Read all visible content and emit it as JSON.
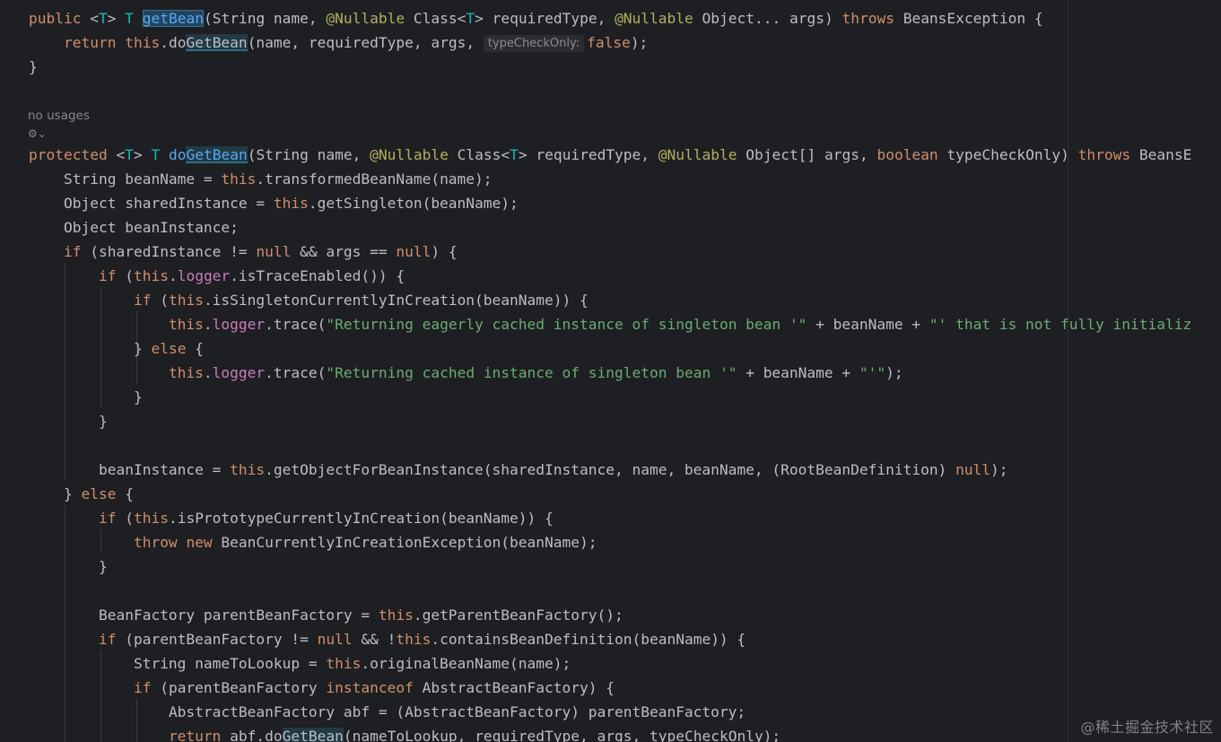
{
  "editor": {
    "lens": {
      "no_usages": "no usages"
    },
    "hint": {
      "param_name": "typeCheckOnly:"
    },
    "line1": {
      "mod": "public",
      "gen_open": "<",
      "type_param": "T",
      "gen_close": ">",
      "ret": "T",
      "name": "getBean",
      "params_a": "(String name, ",
      "ann1": "@Nullable",
      "params_b": " Class<",
      "type_param2": "T",
      "params_c": "> requiredType, ",
      "ann2": "@Nullable",
      "params_d": " Object... args) ",
      "throws_kw": "throws",
      "tail": " BeansException {"
    },
    "line2": {
      "ret_kw": "return",
      "this_kw": "this",
      "dot": ".do",
      "call": "GetBean",
      "args": "(name, requiredType, args, ",
      "false_kw": "false",
      "end": ");"
    },
    "line3": {
      "brace": "}"
    },
    "line4": {
      "mod": "protected",
      "gen_open": "<",
      "type_param": "T",
      "gen_close": ">",
      "ret": "T",
      "name_pre": "do",
      "name_hl": "GetBean",
      "params_a": "(String name, ",
      "ann1": "@Nullable",
      "params_b": " Class<",
      "type_param2": "T",
      "params_c": "> requiredType, ",
      "ann2": "@Nullable",
      "params_d": " Object[] args, ",
      "bool_kw": "boolean",
      "params_e": " typeCheckOnly) ",
      "throws_kw": "throws",
      "tail": " BeansE"
    },
    "line5": {
      "a": "String beanName = ",
      "this_kw": "this",
      "b": ".transformedBeanName(name);"
    },
    "line6": {
      "a": "Object sharedInstance = ",
      "this_kw": "this",
      "b": ".getSingleton(beanName);"
    },
    "line7": {
      "a": "Object beanInstance;"
    },
    "line8": {
      "if_kw": "if",
      "a": " (sharedInstance != ",
      "null1": "null",
      "b": " && args == ",
      "null2": "null",
      "c": ") {"
    },
    "line9": {
      "if_kw": "if",
      "a": " (",
      "this_kw": "this",
      "b": ".",
      "field": "logger",
      "c": ".isTraceEnabled()) {"
    },
    "line10": {
      "if_kw": "if",
      "a": " (",
      "this_kw": "this",
      "b": ".isSingletonCurrentlyInCreation(beanName)) {"
    },
    "line11": {
      "this_kw": "this",
      "b": ".",
      "field": "logger",
      "c": ".trace(",
      "s1": "\"Returning eagerly cached instance of singleton bean '\"",
      "d": " + beanName + ",
      "s2": "\"' that is not fully initializ"
    },
    "line12": {
      "a": "} ",
      "else_kw": "else",
      "b": " {"
    },
    "line13": {
      "this_kw": "this",
      "b": ".",
      "field": "logger",
      "c": ".trace(",
      "s1": "\"Returning cached instance of singleton bean '\"",
      "d": " + beanName + ",
      "s2": "\"'\"",
      "e": ");"
    },
    "line14": {
      "brace": "}"
    },
    "line15": {
      "brace": "}"
    },
    "line16": {
      "a": "beanInstance = ",
      "this_kw": "this",
      "b": ".getObjectForBeanInstance(sharedInstance, name, beanName, (RootBeanDefinition) ",
      "null_kw": "null",
      "c": ");"
    },
    "line17": {
      "a": "} ",
      "else_kw": "else",
      "b": " {"
    },
    "line18": {
      "if_kw": "if",
      "a": " (",
      "this_kw": "this",
      "b": ".isPrototypeCurrentlyInCreation(beanName)) {"
    },
    "line19": {
      "throw_kw": "throw",
      "sp": " ",
      "new_kw": "new",
      "b": " BeanCurrentlyInCreationException(beanName);"
    },
    "line20": {
      "brace": "}"
    },
    "line21": {
      "a": "BeanFactory parentBeanFactory = ",
      "this_kw": "this",
      "b": ".getParentBeanFactory();"
    },
    "line22": {
      "if_kw": "if",
      "a": " (parentBeanFactory != ",
      "null_kw": "null",
      "b": " && !",
      "this_kw": "this",
      "c": ".containsBeanDefinition(beanName)) {"
    },
    "line23": {
      "a": "String nameToLookup = ",
      "this_kw": "this",
      "b": ".originalBeanName(name);"
    },
    "line24": {
      "if_kw": "if",
      "a": " (parentBeanFactory ",
      "inst_kw": "instanceof",
      "b": " AbstractBeanFactory) {"
    },
    "line25": {
      "a": "AbstractBeanFactory abf = (AbstractBeanFactory) parentBeanFactory;"
    },
    "line26": {
      "ret_kw": "return",
      "a": " abf.do",
      "call": "GetBean",
      "b": "(nameToLookup, requiredType, args, typeCheckOnly);"
    }
  },
  "watermark": "@稀土掘金技术社区",
  "colors": {
    "background": "#1e1f22",
    "keyword": "#cf8e6d",
    "function": "#56a8f5",
    "annotation": "#b3ae60",
    "string": "#6aab73",
    "field": "#c77dbb"
  }
}
